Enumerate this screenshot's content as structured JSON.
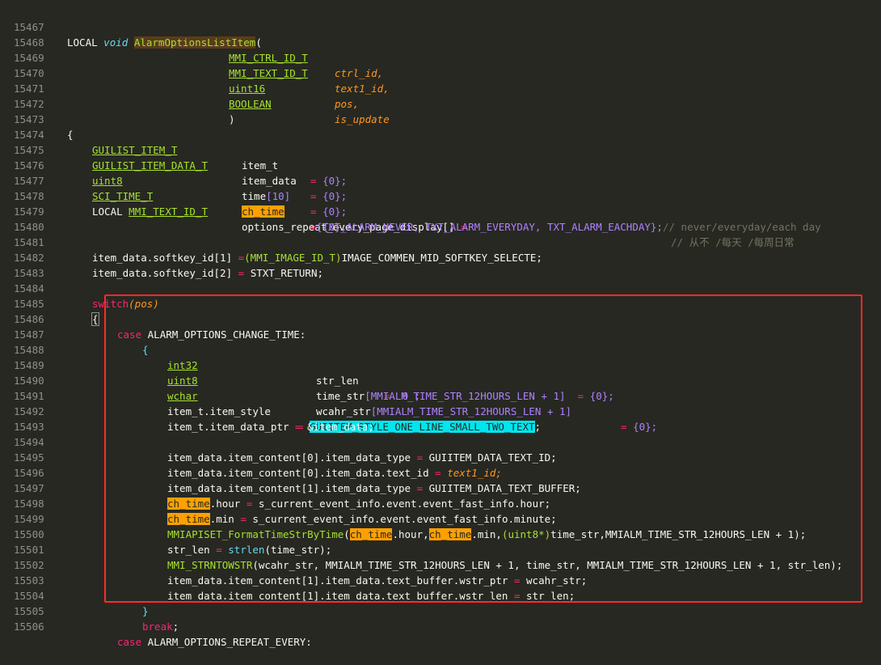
{
  "editor": {
    "lines": [
      {
        "n": "15467"
      },
      {
        "n": "15468"
      },
      {
        "n": "15469"
      },
      {
        "n": "15470"
      },
      {
        "n": "15471"
      },
      {
        "n": "15472"
      },
      {
        "n": "15473"
      },
      {
        "n": "15474"
      },
      {
        "n": "15475"
      },
      {
        "n": "15476"
      },
      {
        "n": "15477"
      },
      {
        "n": "15478"
      },
      {
        "n": "15479"
      },
      {
        "n": "15480"
      },
      {
        "n": "15481"
      },
      {
        "n": "15482"
      },
      {
        "n": "15483"
      },
      {
        "n": "15484"
      },
      {
        "n": "15485"
      },
      {
        "n": "15486"
      },
      {
        "n": "15487"
      },
      {
        "n": "15488"
      },
      {
        "n": "15489"
      },
      {
        "n": "15490"
      },
      {
        "n": "15491"
      },
      {
        "n": "15492"
      },
      {
        "n": "15493"
      },
      {
        "n": "15494"
      },
      {
        "n": "15495"
      },
      {
        "n": "15496"
      },
      {
        "n": "15497"
      },
      {
        "n": "15498"
      },
      {
        "n": "15499"
      },
      {
        "n": "15500"
      },
      {
        "n": "15501"
      },
      {
        "n": "15502"
      },
      {
        "n": "15503"
      },
      {
        "n": "15504"
      },
      {
        "n": "15505"
      },
      {
        "n": "15506"
      }
    ],
    "t": {
      "local": "LOCAL",
      "void": "void",
      "func": "AlarmOptionsListItem",
      "lparen": "(",
      "rparen": ")",
      "mmi_ctrl": "MMI_CTRL_ID_T",
      "ctrl_id": "ctrl_id,",
      "mmi_text": "MMI_TEXT_ID_T",
      "text1_id": "text1_id,",
      "uint16": "uint16",
      "pos": "pos,",
      "boolean": "BOOLEAN",
      "is_update": "is_update",
      "lbrace": "{",
      "rbrace": "}",
      "guilist_item": "GUILIST_ITEM_T",
      "item_t": "item_t",
      "eq": "=",
      "zero_init": "{0};",
      "guilist_item_data": "GUILIST_ITEM_DATA_T",
      "item_data": "item_data",
      "uint8": "uint8",
      "time": "time",
      "ten": "[10]",
      "sci_time": "SCI_TIME_T",
      "ch_time": "ch_time",
      "mmi_text2": "MMI_TEXT_ID_T",
      "options_repeat": "options_repeat_every_page_display[]",
      "comment_cn": "// 从不 /每天 /每周日常",
      "repeat_values": "{TXT_ALARM_NEVER, TXT_ALARM_EVERYDAY, TXT_ALARM_EACHDAY};",
      "comment_en": "// never/everyday/each day",
      "softkey1_a": "item_data.softkey_id[1]",
      "cast_img": "(MMI_IMAGE_ID_T)",
      "img_val": "IMAGE_COMMEN_MID_SOFTKEY_SELECTE;",
      "softkey2_a": "item_data.softkey_id[2]",
      "stxt": "STXT_RETURN;",
      "switch": "switch",
      "pos_arg": "(pos)",
      "case": "case",
      "case1": "ALARM_OPTIONS_CHANGE_TIME:",
      "int32": "int32",
      "str_len_decl": "str_len",
      "zero": "0 ;",
      "time_str": "time_str",
      "mmialm_len": "[MMIALM_TIME_STR_12HOURS_LEN",
      "plus1": "+ 1]",
      "wchar": "wchar",
      "wcahr_str": "wcahr_str",
      "item_style": "item_t.item_style",
      "style_val": "GUIITEM_STYLE_ONE_LINE_SMALL_TWO_TEXT",
      "semi": ";",
      "item_data_ptr": "item_t.item_data_ptr",
      "amp_item": "&item_data;",
      "ic0_type": "item_data.item_content[0].item_data_type",
      "text_id_val": "GUIITEM_DATA_TEXT_ID;",
      "ic0_text": "item_data.item_content[0].item_data.text_id",
      "text1_val": "text1_id;",
      "ic1_type": "item_data.item_content[1].item_data_type",
      "text_buf_val": "GUIITEM_DATA_TEXT_BUFFER;",
      "hour_field": ".hour",
      "hour_val": "s_current_event_info.event.event_fast_info.hour;",
      "min_field": ".min",
      "min_val": "s_current_event_info.event.event_fast_info.minute;",
      "fmt_func": "MMIAPISET_FormatTimeStrByTime",
      "fmt_rest1": ".hour,",
      "fmt_rest2": ".min,",
      "fmt_cast": "(uint8*)",
      "fmt_tail": "time_str,MMIALM_TIME_STR_12HOURS_LEN + 1);",
      "str_len_assign": "str_len",
      "strlen_call": "strlen",
      "strlen_arg": "(time_str);",
      "strn_func": "MMI_STRNTOWSTR",
      "strn_args": "(wcahr_str, MMIALM_TIME_STR_12HOURS_LEN + 1, time_str, MMIALM_TIME_STR_12HOURS_LEN + 1, str_len);",
      "wstr_ptr": "item_data.item_content[1].item_data.text_buffer.wstr_ptr",
      "wcahr_semi": "wcahr_str;",
      "wstr_len": "item_data.item_content[1].item_data.text_buffer.wstr_len",
      "str_len_semi": "str_len;",
      "break": "break",
      "case2": "ALARM_OPTIONS_REPEAT_EVERY:"
    }
  }
}
